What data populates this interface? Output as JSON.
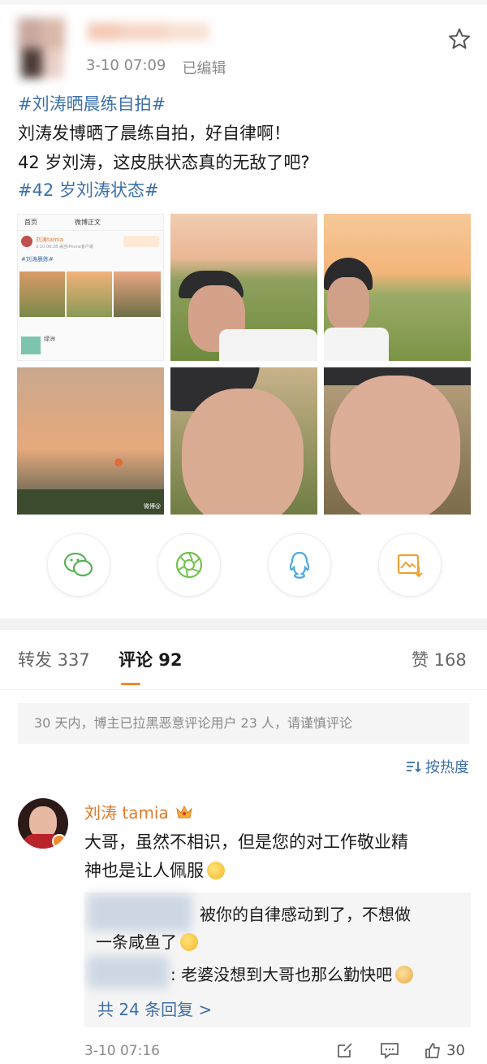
{
  "post": {
    "time": "3-10 07:09",
    "edited": "已编辑",
    "line1": "#刘涛晒晨练自拍#",
    "line2": "刘涛发博晒了晨练自拍，好自律啊！",
    "line3": "42 岁刘涛，这皮肤状态真的无敌了吧?",
    "line4": "#42 岁刘涛状态#",
    "icon": "star-icon"
  },
  "thumbnail": {
    "tab1": "首页",
    "tab2": "微博正文",
    "user": "刘涛tamia",
    "time": "3-10 06:28 来自iPhone客户端",
    "tag": "#刘涛晨练#",
    "place": "绿洲",
    "watermark": "微博@"
  },
  "share": {
    "icons": [
      "wechat-icon",
      "moments-icon",
      "qq-icon",
      "save-image-icon"
    ]
  },
  "tabs": {
    "repost": "转发 337",
    "comment": "评论 92",
    "like": "赞 168"
  },
  "notice": "30 天内，博主已拉黑恶意评论用户 23 人，请谨慎评论",
  "sort": "按热度",
  "comment": {
    "name": "刘涛 tamia",
    "text_line1": "大哥，虽然不相识，但是您的对工作敬业精",
    "text_line2": "神也是让人佩服",
    "reply1_line1": "被你的自律感动到了，不想做",
    "reply1_line2": "一条咸鱼了",
    "reply2": ": 老婆没想到大哥也那么勤快吧",
    "more": "共 24 条回复 >",
    "time": "3-10 07:16",
    "count": "30"
  },
  "colors": {
    "link": "#3d6fa8",
    "accent": "#f08a2c",
    "name": "#e07a2a"
  }
}
